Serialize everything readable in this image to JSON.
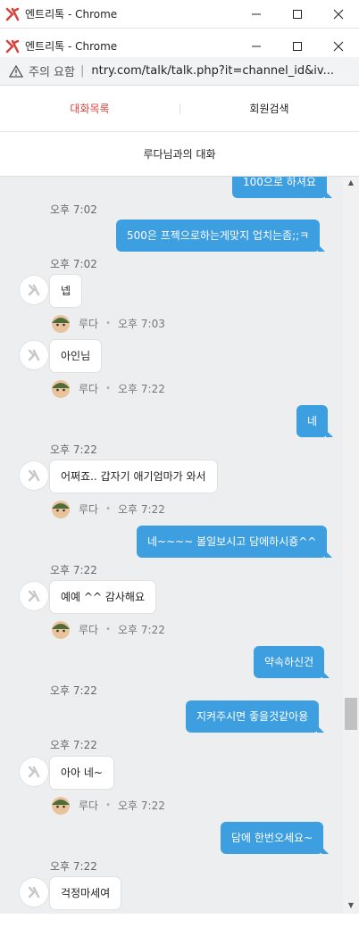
{
  "window": {
    "title_outer": "엔트리톡 - Chrome",
    "title_inner": "엔트리톡 - Chrome"
  },
  "addressbar": {
    "warning": "주의 요함",
    "separator": "|",
    "url": "ntry.com/talk/talk.php?it=channel_id&iv..."
  },
  "tabs": [
    {
      "label": "대화목록",
      "active": true
    },
    {
      "label": "회원검색",
      "active": false
    }
  ],
  "chat": {
    "title": "루다님과의 대화",
    "messages": [
      {
        "side": "right",
        "text": "100으로 하셔요"
      },
      {
        "side": "time",
        "text": "오후 7:02"
      },
      {
        "side": "right",
        "text": "500은 프젝으로하는게맞지 업치는좀;;ㅋ"
      },
      {
        "side": "time",
        "text": "오후 7:02"
      },
      {
        "side": "left",
        "text": "넵",
        "name": "루다",
        "time": "오후 7:03"
      },
      {
        "side": "left",
        "text": "아인님",
        "name": "루다",
        "time": "오후 7:22"
      },
      {
        "side": "right",
        "text": "네"
      },
      {
        "side": "time",
        "text": "오후 7:22"
      },
      {
        "side": "left",
        "text": "어쩌죠.. 갑자기 애기엄마가 와서",
        "name": "루다",
        "time": "오후 7:22"
      },
      {
        "side": "right",
        "text": "네~~~~ 볼일보시고 담에하시죵^^"
      },
      {
        "side": "time",
        "text": "오후 7:22"
      },
      {
        "side": "left",
        "text": "예예 ^^ 감사해요",
        "name": "루다",
        "time": "오후 7:22"
      },
      {
        "side": "right",
        "text": "약속하신건"
      },
      {
        "side": "time",
        "text": "오후 7:22"
      },
      {
        "side": "right",
        "text": "지켜주시면 좋을것같아용"
      },
      {
        "side": "time",
        "text": "오후 7:22"
      },
      {
        "side": "left",
        "text": "아아 네~",
        "name": "루다",
        "time": "오후 7:22"
      },
      {
        "side": "right",
        "text": "담에 한번오세요~"
      },
      {
        "side": "time",
        "text": "오후 7:22"
      },
      {
        "side": "left",
        "text": "걱정마세여"
      }
    ]
  },
  "colors": {
    "accent": "#d9423a",
    "bubble_mine": "#3d9fe0",
    "chat_bg": "#eceef0"
  }
}
